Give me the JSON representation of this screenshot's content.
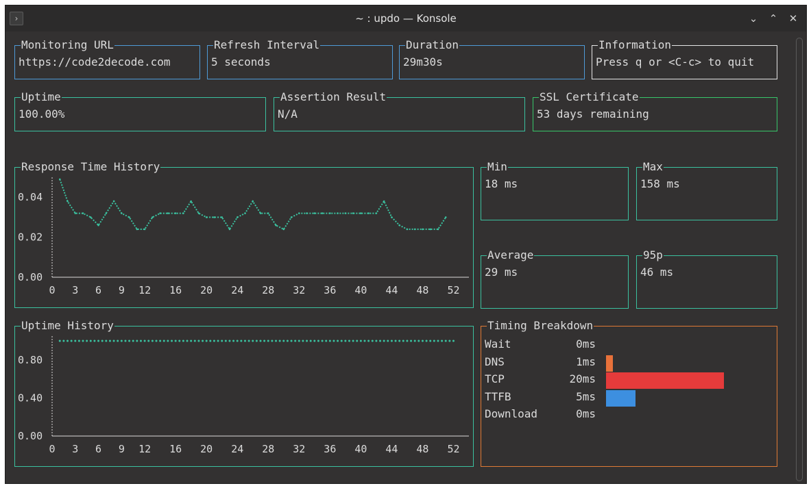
{
  "window": {
    "title": "~ : updo — Konsole",
    "app_icon": "›",
    "controls": {
      "minimize": "⌄",
      "maximize": "⌃",
      "close": "✕"
    }
  },
  "info": {
    "monitoring_url": {
      "label": "Monitoring URL",
      "value": "https://code2decode.com"
    },
    "refresh_interval": {
      "label": "Refresh Interval",
      "value": "5 seconds"
    },
    "duration": {
      "label": "Duration",
      "value": "29m30s"
    },
    "information": {
      "label": "Information",
      "value": "Press q or <C-c> to quit"
    }
  },
  "status": {
    "uptime": {
      "label": "Uptime",
      "value": "100.00%"
    },
    "assertion": {
      "label": "Assertion Result",
      "value": "N/A"
    },
    "ssl": {
      "label": "SSL Certificate",
      "value": "53 days remaining"
    }
  },
  "stats": {
    "min": {
      "label": "Min",
      "value": "18 ms"
    },
    "max": {
      "label": "Max",
      "value": "158 ms"
    },
    "average": {
      "label": "Average",
      "value": "29 ms"
    },
    "p95": {
      "label": "95p",
      "value": "46 ms"
    }
  },
  "timing": {
    "label": "Timing Breakdown",
    "rows": [
      {
        "name": "Wait",
        "value": "0ms",
        "ms": 0,
        "color": "#e8713a"
      },
      {
        "name": "DNS",
        "value": "1ms",
        "ms": 1,
        "color": "#e8713a"
      },
      {
        "name": "TCP",
        "value": "20ms",
        "ms": 20,
        "color": "#e53b3b"
      },
      {
        "name": "TTFB",
        "value": "5ms",
        "ms": 5,
        "color": "#3d8fe0"
      },
      {
        "name": "Download",
        "value": "0ms",
        "ms": 0,
        "color": "#3d8fe0"
      }
    ]
  },
  "chart_data": [
    {
      "type": "line",
      "title": "Response Time History",
      "color": "#3bc2a0",
      "y_ticks": [
        "0.00",
        "0.02",
        "0.04"
      ],
      "ylim": [
        0,
        0.05
      ],
      "x_ticks": [
        "0",
        "3",
        "6",
        "9",
        "12",
        "16",
        "20",
        "24",
        "28",
        "32",
        "36",
        "40",
        "44",
        "48",
        "52"
      ],
      "xlim": [
        0,
        54
      ],
      "x": [
        1,
        2,
        3,
        4,
        5,
        6,
        7,
        8,
        9,
        10,
        11,
        12,
        13,
        14,
        15,
        16,
        17,
        18,
        19,
        20,
        21,
        22,
        23,
        24,
        25,
        26,
        27,
        28,
        29,
        30,
        31,
        32,
        33,
        34,
        35,
        36,
        37,
        38,
        39,
        40,
        41,
        42,
        43,
        44,
        45,
        46,
        47,
        48,
        49,
        50,
        51
      ],
      "values": [
        0.049,
        0.038,
        0.032,
        0.032,
        0.03,
        0.026,
        0.032,
        0.038,
        0.032,
        0.03,
        0.024,
        0.024,
        0.03,
        0.032,
        0.032,
        0.032,
        0.032,
        0.038,
        0.032,
        0.03,
        0.03,
        0.03,
        0.024,
        0.03,
        0.032,
        0.038,
        0.032,
        0.032,
        0.026,
        0.024,
        0.03,
        0.032,
        0.032,
        0.032,
        0.032,
        0.032,
        0.032,
        0.032,
        0.032,
        0.032,
        0.032,
        0.032,
        0.038,
        0.03,
        0.026,
        0.024,
        0.024,
        0.024,
        0.024,
        0.024,
        0.03
      ]
    },
    {
      "type": "scatter",
      "title": "Uptime History",
      "color": "#3bc2a0",
      "y_ticks": [
        "0.00",
        "0.40",
        "0.80"
      ],
      "ylim": [
        0,
        1.05
      ],
      "x_ticks": [
        "0",
        "3",
        "6",
        "9",
        "12",
        "16",
        "20",
        "24",
        "28",
        "32",
        "36",
        "40",
        "44",
        "48",
        "52"
      ],
      "xlim": [
        0,
        54
      ],
      "x_start": 1,
      "x_end": 52,
      "x_step": 0.5,
      "value": 1.0
    }
  ]
}
